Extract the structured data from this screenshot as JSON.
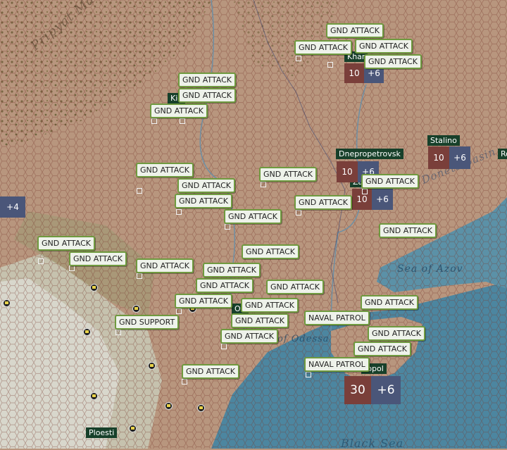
{
  "map_labels": {
    "sea_of_azov": "Sea of Azov",
    "donets_basin": "Donets Basin",
    "pripyat_marshes": "Pripyat Marshes",
    "gulf_of_odessa": "of Odessa",
    "black_sea": "Black Sea",
    "karkov_partial": "Khar",
    "kiev_partial": "Kie",
    "odessa_partial": "Od",
    "zap_partial": "Za",
    "sevastopol_partial": "topol",
    "rostov_partial": "Ro"
  },
  "cities": {
    "dnepropetrovsk": "Dnepropetrovsk",
    "stalino": "Stalino",
    "ploesti": "Ploesti"
  },
  "stacks": {
    "kharkov": {
      "axis": "10",
      "allied": "+6"
    },
    "dnepropetrovsk": {
      "axis": "10",
      "allied": "+6"
    },
    "zaporozhye": {
      "axis": "10",
      "allied": "+6"
    },
    "stalino": {
      "axis": "10",
      "allied": "+6"
    },
    "west_edge": {
      "allied": "+4"
    },
    "sevastopol": {
      "axis": "30",
      "allied": "+6"
    }
  },
  "missions": [
    "GND ATTACK",
    "GND ATTACK",
    "GND ATTACK",
    "GND ATTACK",
    "GND ATTACK",
    "GND ATTACK",
    "GND ATTACK",
    "GND ATTACK",
    "GND ATTACK",
    "GND ATTACK",
    "GND ATTACK",
    "GND ATTACK",
    "GND ATTACK",
    "GND ATTACK",
    "GND ATTACK",
    "GND ATTACK",
    "GND ATTACK",
    "GND ATTACK",
    "GND ATTACK",
    "GND ATTACK",
    "GND ATTACK",
    "GND ATTACK",
    "GND ATTACK",
    "GND ATTACK",
    "GND ATTACK",
    "GND ATTACK",
    "GND ATTACK",
    "GND ATTACK",
    "GND SUPPORT",
    "NAVAL PATROL",
    "NAVAL PATROL"
  ],
  "colors": {
    "land": "#b8967e",
    "sea": "#4c86a0",
    "mission_border": "#6f9a3f",
    "city_bg": "#17402a",
    "axis_bg": "#7a3f3a",
    "allied_bg": "#4a5679"
  }
}
